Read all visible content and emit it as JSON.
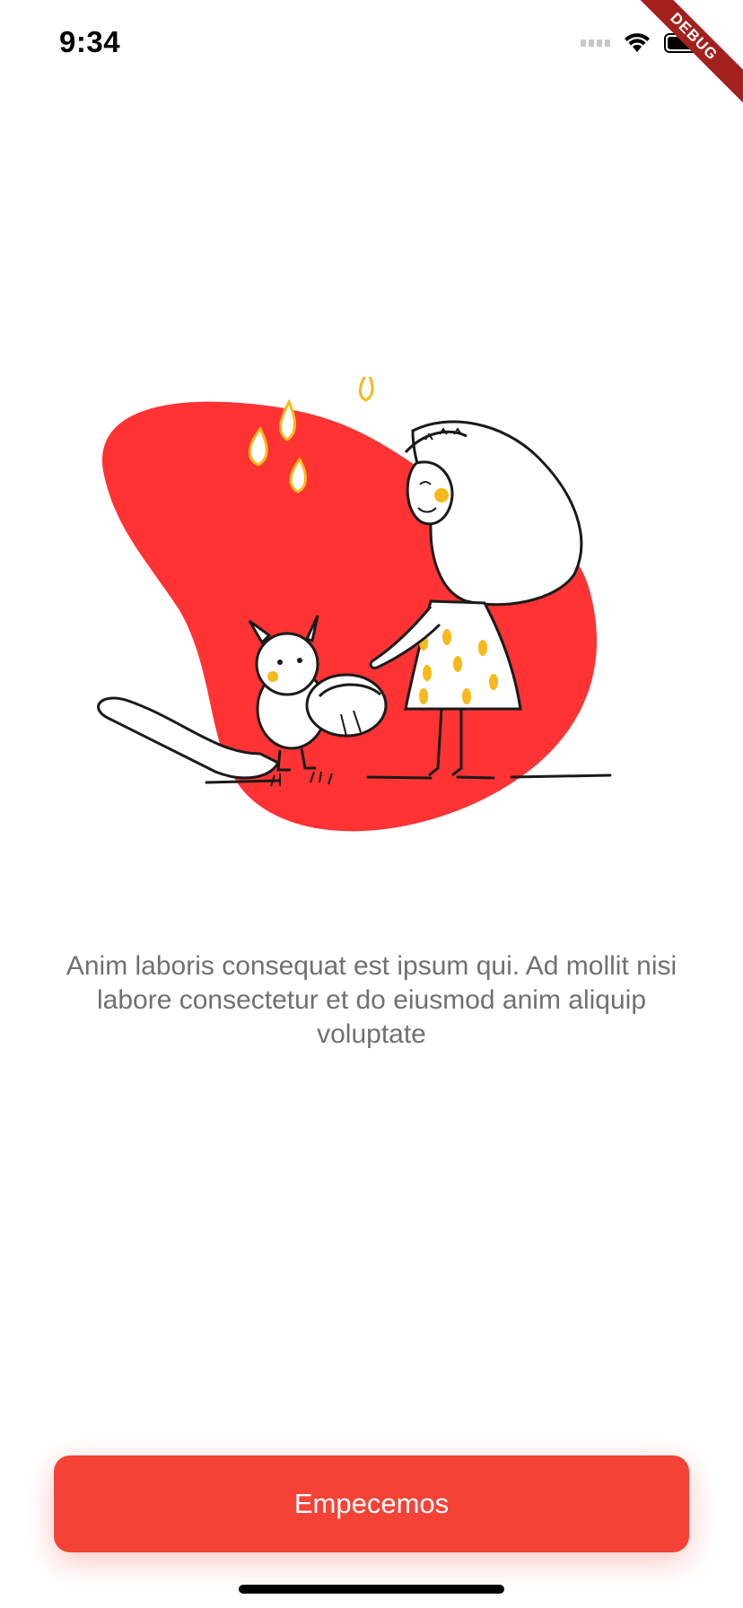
{
  "status_bar": {
    "time": "9:34",
    "icons": [
      "signal-icon",
      "wifi-icon",
      "battery-icon"
    ]
  },
  "debug_banner": {
    "label": "DEBUG"
  },
  "illustration": {
    "description_icon": "girl-and-squirrel-illustration",
    "blob_color": "#ff3333",
    "accent_color": "#f9b91b"
  },
  "onboarding": {
    "body_text": "Anim laboris consequat est ipsum qui. Ad mollit nisi labore consectetur et do eiusmod anim aliquip voluptate",
    "start_button_label": "Empecemos"
  },
  "colors": {
    "primary": "#f44336",
    "text_muted": "#707070"
  }
}
